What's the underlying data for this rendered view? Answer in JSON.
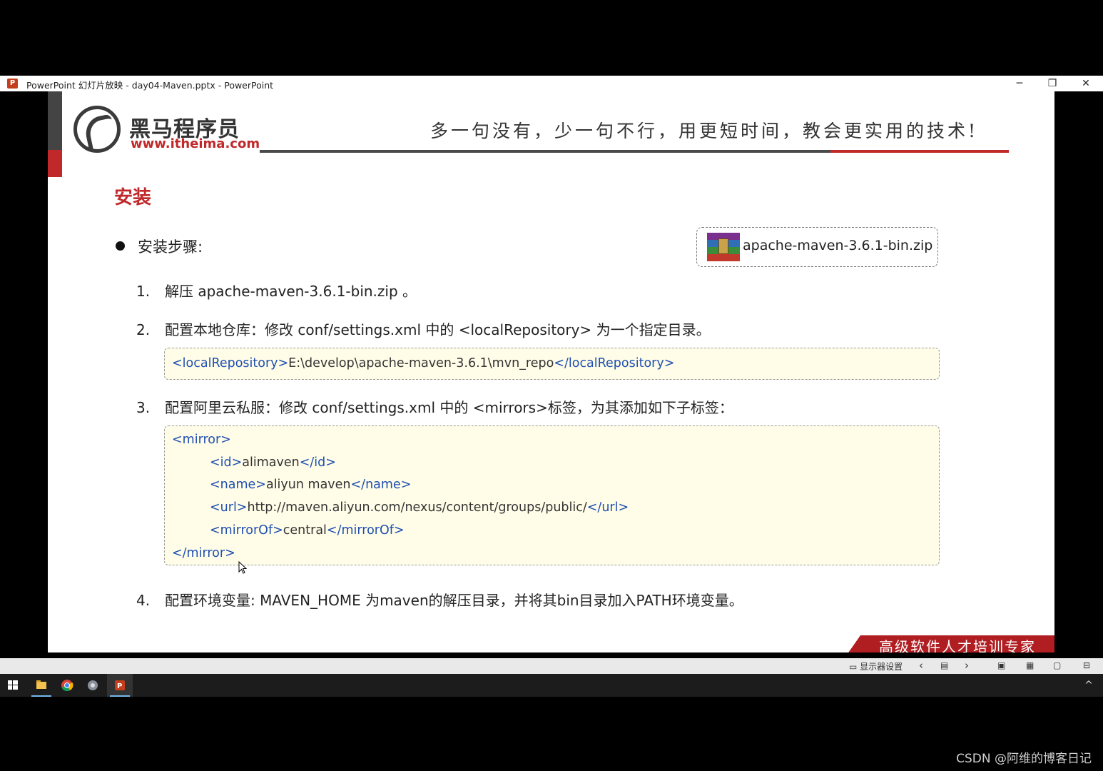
{
  "window": {
    "app_icon": "powerpoint-icon",
    "title": "PowerPoint 幻灯片放映  -  day04-Maven.pptx - PowerPoint",
    "minimize": "─",
    "restore": "❐",
    "close": "✕"
  },
  "slide": {
    "logo_cn": "黑马程序员",
    "logo_url": "www.itheima.com",
    "slogan": "多一句没有，少一句不行，用更短时间，教会更实用的技术!",
    "heading": "安装",
    "bullet": "安装步骤:",
    "file_label": "apache-maven-3.6.1-bin.zip",
    "steps": [
      {
        "num": "1.",
        "text": "解压 apache-maven-3.6.1-bin.zip 。"
      },
      {
        "num": "2.",
        "text": "配置本地仓库：修改 conf/settings.xml 中的 <localRepository> 为一个指定目录。"
      },
      {
        "num": "3.",
        "text": "配置阿里云私服：修改 conf/settings.xml 中的 <mirrors>标签，为其添加如下子标签："
      },
      {
        "num": "4.",
        "text": "配置环境变量: MAVEN_HOME 为maven的解压目录，并将其bin目录加入PATH环境变量。"
      }
    ],
    "code1": {
      "open": "<localRepository>",
      "value": "E:\\develop\\apache-maven-3.6.1\\mvn_repo",
      "close": "</localRepository>"
    },
    "code2": {
      "mirror_open": "<mirror>",
      "id_open": "<id>",
      "id_value": "alimaven",
      "id_close": "</id>",
      "name_open": "<name>",
      "name_value": "aliyun maven",
      "name_close": "</name>",
      "url_open": "<url>",
      "url_value": "http://maven.aliyun.com/nexus/content/groups/public/",
      "url_close": "</url>",
      "mirrorof_open": "<mirrorOf>",
      "mirrorof_value": "central",
      "mirrorof_close": "</mirrorOf>",
      "mirror_close": "</mirror>"
    },
    "corner_text": "高级软件人才培训专家"
  },
  "controls": {
    "display_settings": "显示器设置",
    "prev": "‹",
    "next": "›"
  },
  "taskbar": {
    "items": [
      "start-icon",
      "file-explorer-icon",
      "chrome-icon",
      "app-icon",
      "powerpoint-icon"
    ],
    "tray_chevron": "^"
  },
  "watermark": "CSDN @阿维的博客日记",
  "colors": {
    "brand_red": "#c0282a",
    "code_tag_blue": "#1f4fb0",
    "code_bg": "#fffde8"
  }
}
